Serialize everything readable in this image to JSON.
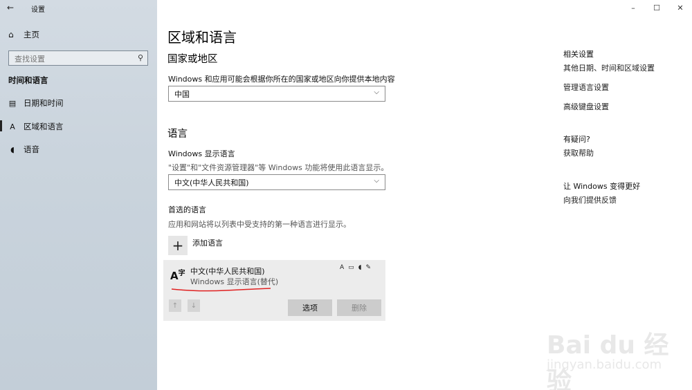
{
  "window": {
    "title": "设置",
    "back_icon": "←",
    "controls": [
      "–",
      "☐",
      "✕"
    ]
  },
  "sidebar": {
    "home_label": "主页",
    "search_placeholder": "查找设置",
    "section_header": "时间和语言",
    "items": [
      {
        "label": "日期和时间",
        "icon": "calendar-clock-icon"
      },
      {
        "label": "区域和语言",
        "icon": "language-icon",
        "selected": true
      },
      {
        "label": "语音",
        "icon": "microphone-icon"
      }
    ]
  },
  "main": {
    "page_title": "区域和语言",
    "country": {
      "heading": "国家或地区",
      "description": "Windows 和应用可能会根据你所在的国家或地区向你提供本地内容",
      "selected": "中国"
    },
    "language": {
      "heading": "语言",
      "display_label": "Windows 显示语言",
      "display_description": "\"设置\"和\"文件资源管理器\"等 Windows 功能将使用此语言显示。",
      "display_selected": "中文(中华人民共和国)",
      "preferred_heading": "首选的语言",
      "preferred_description": "应用和网站将以列表中受支持的第一种语言进行显示。",
      "add_label": "添加语言",
      "languages": [
        {
          "name": "中文(中华人民共和国)",
          "sub": "Windows 显示语言(替代)"
        }
      ],
      "options_label": "选项",
      "remove_label": "删除"
    }
  },
  "right_panel": {
    "related_heading": "相关设置",
    "related_links": [
      "其他日期、时间和区域设置",
      "管理语言设置",
      "高级键盘设置"
    ],
    "help_heading": "有疑问?",
    "help_link": "获取帮助",
    "feedback_heading": "让 Windows 变得更好",
    "feedback_link": "向我们提供反馈"
  },
  "watermark": {
    "text": "Bai du 经验",
    "url": "jingyan.baidu.com"
  }
}
